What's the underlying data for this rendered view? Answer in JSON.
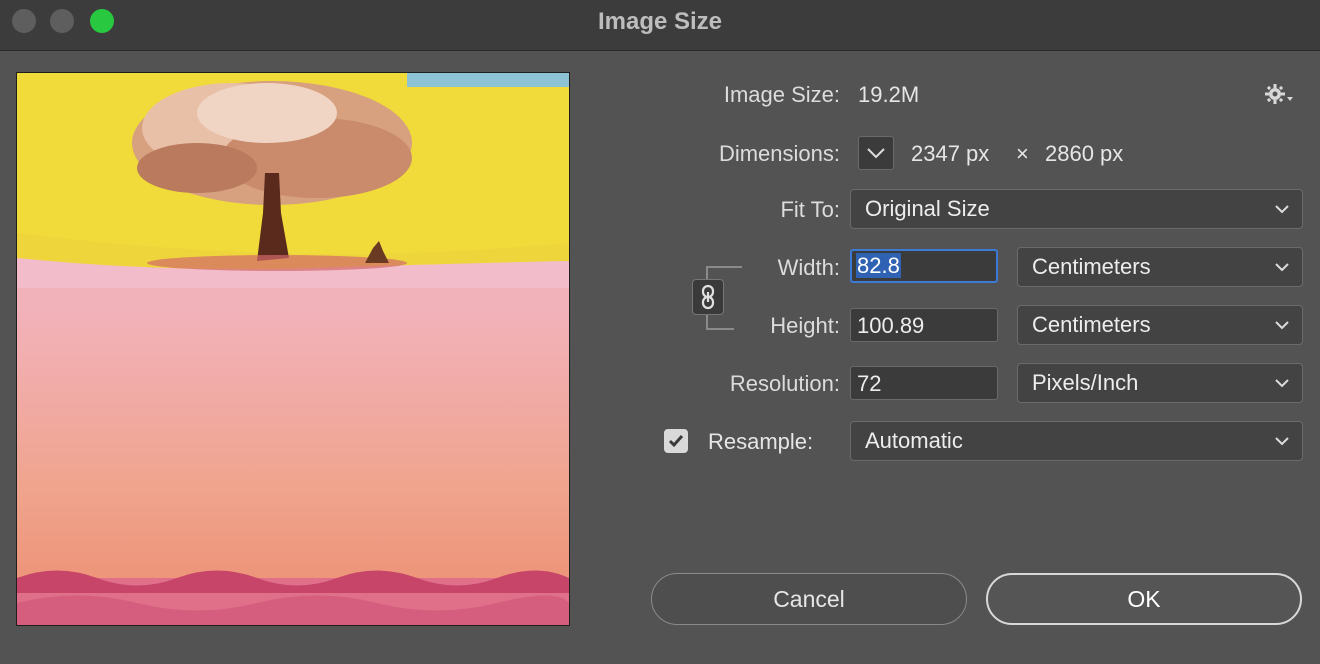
{
  "window": {
    "title": "Image Size"
  },
  "image_size": {
    "label": "Image Size:",
    "value": "19.2M"
  },
  "dimensions": {
    "label": "Dimensions:",
    "width": "2347 px",
    "times": "×",
    "height": "2860 px"
  },
  "fit_to": {
    "label": "Fit To:",
    "selected": "Original Size"
  },
  "width": {
    "label": "Width:",
    "value": "82.8",
    "unit": "Centimeters"
  },
  "height": {
    "label": "Height:",
    "value": "100.89",
    "unit": "Centimeters"
  },
  "resolution": {
    "label": "Resolution:",
    "value": "72",
    "unit": "Pixels/Inch"
  },
  "resample": {
    "label": "Resample:",
    "checked": true,
    "selected": "Automatic"
  },
  "buttons": {
    "cancel": "Cancel",
    "ok": "OK"
  },
  "icons": {
    "gear": "gear-icon",
    "link": "link-icon",
    "chevron": "chevron-down-icon",
    "check": "checkmark-icon"
  },
  "colors": {
    "accent": "#3d7ad6",
    "maximize": "#28c840"
  }
}
